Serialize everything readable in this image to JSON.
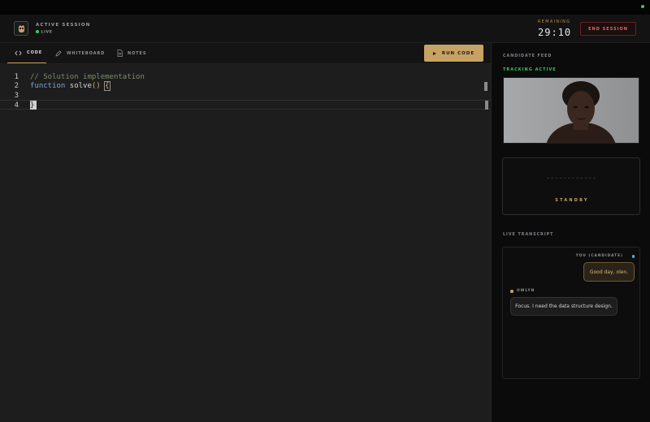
{
  "header": {
    "session_title": "ACTIVE SESSION",
    "live_label": "LIVE",
    "remaining_label": "REMAINING",
    "timer": "29:10",
    "end_button": "END SESSION"
  },
  "tabs": [
    {
      "label": "CODE",
      "icon": "code-icon",
      "active": true
    },
    {
      "label": "WHITEBOARD",
      "icon": "pencil-icon",
      "active": false
    },
    {
      "label": "NOTES",
      "icon": "document-icon",
      "active": false
    }
  ],
  "run_button": "RUN CODE",
  "editor": {
    "line_numbers": [
      "1",
      "2",
      "3",
      "4"
    ],
    "comment": "// Solution implementation",
    "keyword": "function",
    "fn_name": "solve",
    "parens": "()",
    "open_brace": "{",
    "close_brace": "}"
  },
  "sidebar": {
    "feed_label": "CANDIDATE FEED",
    "tracking_label": "TRACKING ACTIVE",
    "standby_label": "STANDBY",
    "transcript_label": "LIVE TRANSCRIPT"
  },
  "transcript": {
    "you_label": "YOU (CANDIDATE)",
    "you_message": "Good day, olen.",
    "other_label": "OWLYN",
    "other_message": "Focus. I need the data structure design."
  },
  "colors": {
    "accent": "#c8a265",
    "live": "#3ec46d",
    "danger": "#e06a5d",
    "you_dot": "#5fa8e3"
  }
}
